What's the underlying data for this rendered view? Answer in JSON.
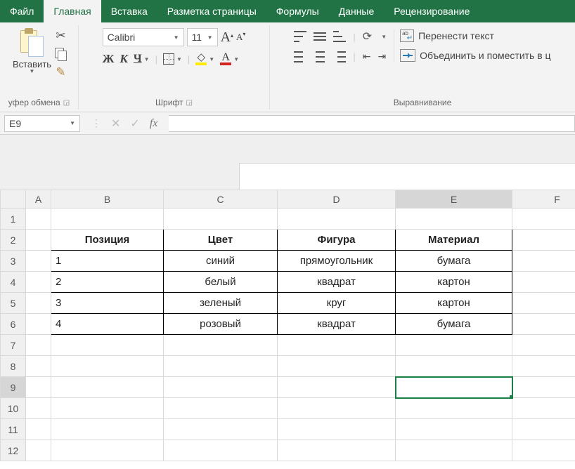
{
  "tabs": {
    "file": "Файл",
    "home": "Главная",
    "insert": "Вставка",
    "pagelayout": "Разметка страницы",
    "formulas": "Формулы",
    "data": "Данные",
    "review": "Рецензирование"
  },
  "ribbon": {
    "clipboard": {
      "paste": "Вставить",
      "label": "уфер обмена"
    },
    "font": {
      "name": "Calibri",
      "size": "11",
      "bold": "Ж",
      "italic": "К",
      "underline": "Ч",
      "label": "Шрифт"
    },
    "alignment": {
      "wrap": "Перенести текст",
      "merge": "Объединить и поместить в ц",
      "label": "Выравнивание"
    }
  },
  "formula_bar": {
    "cell_ref": "E9",
    "fx": "fx"
  },
  "columns": [
    "A",
    "B",
    "C",
    "D",
    "E",
    "F"
  ],
  "row_count": 12,
  "selected": {
    "col": "E",
    "row": 9
  },
  "table": {
    "headers": [
      "Позиция",
      "Цвет",
      "Фигура",
      "Материал"
    ],
    "rows": [
      [
        "1",
        "синий",
        "прямоугольник",
        "бумага"
      ],
      [
        "2",
        "белый",
        "квадрат",
        "картон"
      ],
      [
        "3",
        "зеленый",
        "круг",
        "картон"
      ],
      [
        "4",
        "розовый",
        "квадрат",
        "бумага"
      ]
    ]
  }
}
